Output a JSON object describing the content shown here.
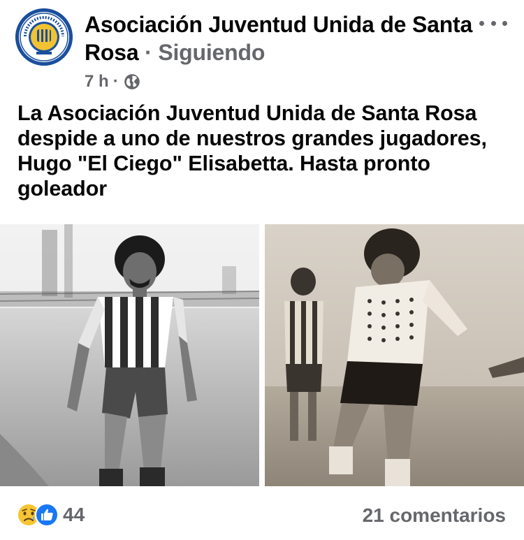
{
  "post": {
    "page_name": "Asociación Juventud Unida de Santa Rosa",
    "separator": "·",
    "follow_status": "Siguiendo",
    "time": "7 h",
    "meta_separator": "·",
    "privacy_icon": "globe-icon",
    "text": "La Asociación Juventud Unida de Santa Rosa despide a uno de nuestros grandes jugadores, Hugo \"El Ciego\" Elisabetta. Hasta pronto goleador",
    "avatar_icon": "club-crest-icon",
    "more_icon": "more-horizontal-icon"
  },
  "photos": [
    {
      "name": "photo-player-standing",
      "tone": "black-and-white"
    },
    {
      "name": "photo-player-running",
      "tone": "sepia"
    }
  ],
  "footer": {
    "reaction_icons": [
      "sad-reaction-icon",
      "like-reaction-icon"
    ],
    "reaction_count": "44",
    "comments_label": "21 comentarios"
  },
  "colors": {
    "text_primary": "#050505",
    "text_secondary": "#65676b",
    "like_blue": "#1877f2",
    "sad_yellow": "#f7c533",
    "crest_blue": "#1a4f9c",
    "crest_gold": "#f1c232"
  }
}
